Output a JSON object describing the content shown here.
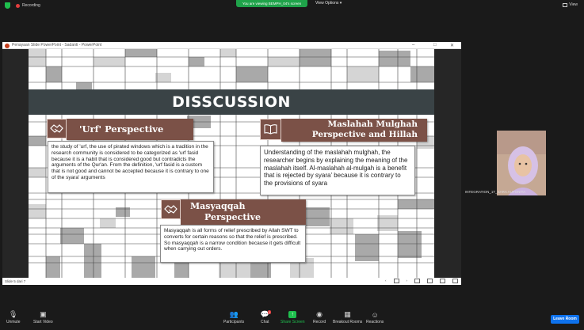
{
  "zoom": {
    "recording_label": "Recording",
    "viewing_banner": "You are viewing BEMPH_04's screen",
    "view_options": "View Options",
    "view_button": "View",
    "participant_name": "INTEGRATION_1T_SARA AUFONITA",
    "toolbar": {
      "unmute": "Unmute",
      "start_video": "Start Video",
      "participants": "Participants",
      "participants_count": "18",
      "chat": "Chat",
      "chat_badge": "1",
      "share_screen": "Share Screen",
      "record": "Record",
      "breakout": "Breakout Rooms",
      "reactions": "Reactions",
      "leave": "Leave Room"
    }
  },
  "ppt": {
    "window_title": "Penayaan Slide PowerPoint - Sadanti - PowerPoint",
    "status_slide": "Slide 5 dari 7"
  },
  "slide": {
    "title": "DISSCUSSION",
    "urf": {
      "heading": "'Urf' Perspective",
      "body": "the study of 'urf, the use of pirated windows which is a tradition in the research community is considered to be categorized as 'urf fasid because it is a habit that is considered good but contradicts the arguments of the Qur'an. From the definition, 'urf fasid is a custom that is not good and cannot be accepted because it is contrary to one of the syara' arguments"
    },
    "maslahah": {
      "heading_line1": "Maslahah Mulghah",
      "heading_line2": "Perspective and Hillah",
      "body": "Understanding of the maslahah mulghah, the researcher begins by explaining the meaning of the maslahah itself. Al-maslahah al-mulgah is a benefit that is rejected by syara' because it is contrary to the provisions of syara"
    },
    "masyaqqah": {
      "heading_line1": "Masyaqqah",
      "heading_line2": "Perspective",
      "body": "Masyaqqah is all forms of relief prescribed by Allah SWT to converts for certain reasons so that the relief is prescribed. So masyaqqah is a narrow condition because it gets difficult when carrying out orders."
    }
  },
  "colors": {
    "banner": "#3a4346",
    "accent": "#7b5147",
    "share_green": "#1fbf4e",
    "leave_blue": "#0e72ed"
  }
}
